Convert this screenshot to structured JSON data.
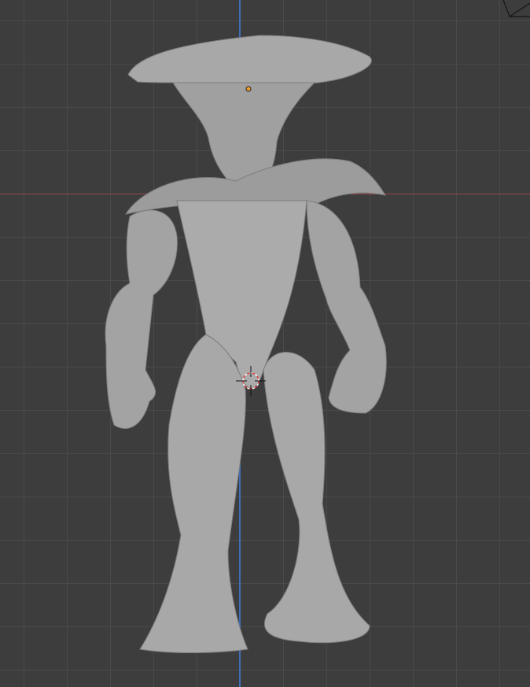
{
  "viewport": {
    "mode": "3d-viewport",
    "view": "front-orthographic",
    "grid": true,
    "colors": {
      "background": "#3d3d3d",
      "grid": "#4a4a4a",
      "x_axis": "#9a4450",
      "z_axis": "#3f6fb8",
      "mesh": "#a9a9a9",
      "origin": "#f0a030"
    },
    "objects": [
      {
        "name_icon": "mushroom-creature-sculpt-mesh"
      },
      {
        "name_icon": "3d-cursor-icon"
      },
      {
        "name_icon": "camera-icon"
      }
    ]
  }
}
